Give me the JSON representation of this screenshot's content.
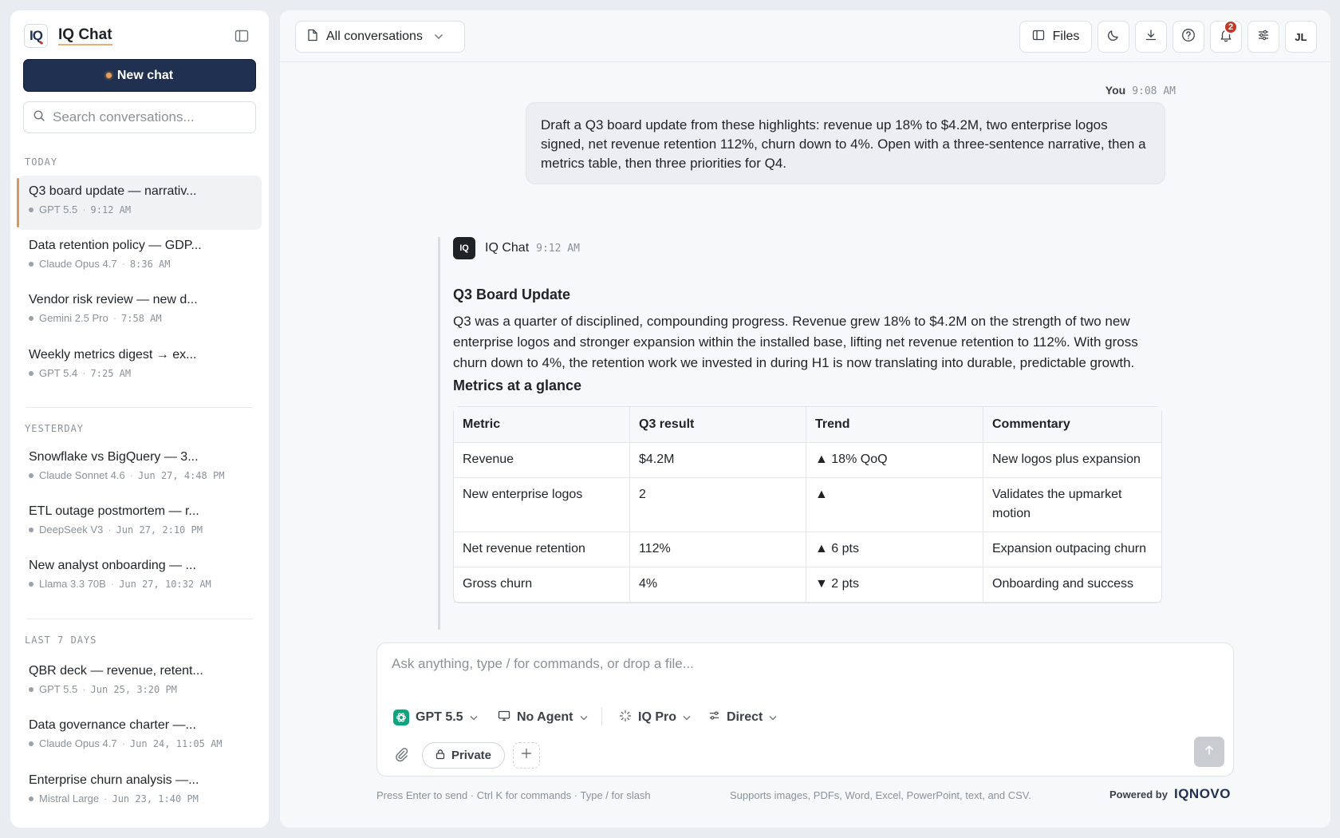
{
  "sidebar": {
    "brand_logo": "IQ",
    "brand_name": "IQ Chat",
    "new_chat": "New chat",
    "search_placeholder": "Search conversations...",
    "groups": {
      "today": "TODAY",
      "yesterday": "YESTERDAY",
      "last7": "LAST 7 DAYS"
    },
    "conversations": [
      {
        "title": "Q3 board update — narrativ...",
        "model": "GPT 5.5",
        "time": "9:12 AM"
      },
      {
        "title": "Data retention policy — GDP...",
        "model": "Claude Opus 4.7",
        "time": "8:36 AM"
      },
      {
        "title": "Vendor risk review — new d...",
        "model": "Gemini 2.5 Pro",
        "time": "7:58 AM"
      },
      {
        "title": "Weekly metrics digest → ex...",
        "model": "GPT 5.4",
        "time": "7:25 AM"
      },
      {
        "title": "Snowflake vs BigQuery — 3...",
        "model": "Claude Sonnet 4.6",
        "time": "Jun 27, 4:48 PM"
      },
      {
        "title": "ETL outage postmortem — r...",
        "model": "DeepSeek V3",
        "time": "Jun 27, 2:10 PM"
      },
      {
        "title": "New analyst onboarding — ...",
        "model": "Llama 3.3 70B",
        "time": "Jun 27, 10:32 AM"
      },
      {
        "title": "QBR deck — revenue, retent...",
        "model": "GPT 5.5",
        "time": "Jun 25, 3:20 PM"
      },
      {
        "title": "Data governance charter —...",
        "model": "Claude Opus 4.7",
        "time": "Jun 24, 11:05 AM"
      },
      {
        "title": "Enterprise churn analysis —...",
        "model": "Mistral Large",
        "time": "Jun 23, 1:40 PM"
      }
    ]
  },
  "topbar": {
    "conversation_filter": "All conversations",
    "files": "Files",
    "notification_count": "2",
    "avatar": "JL"
  },
  "chat": {
    "user_name": "You",
    "user_time": "9:08 AM",
    "user_message": "Draft a Q3 board update from these highlights: revenue up 18% to $4.2M, two enterprise logos signed, net revenue retention 112%, churn down to 4%. Open with a three-sentence narrative, then a metrics table, then three priorities for Q4.",
    "assistant_logo": "IQ",
    "assistant_name": "IQ Chat",
    "assistant_time": "9:12 AM",
    "heading": "Q3 Board Update",
    "narrative": "Q3 was a quarter of disciplined, compounding progress. Revenue grew 18% to $4.2M on the strength of two new enterprise logos and stronger expansion within the installed base, lifting net revenue retention to 112%. With gross churn down to 4%, the retention work we invested in during H1 is now translating into durable, predictable growth.",
    "table_heading": "Metrics at a glance",
    "table": {
      "headers": [
        "Metric",
        "Q3 result",
        "Trend",
        "Commentary"
      ],
      "rows": [
        [
          "Revenue",
          "$4.2M",
          "▲ 18% QoQ",
          "New logos plus expansion"
        ],
        [
          "New enterprise logos",
          "2",
          "▲",
          "Validates the upmarket motion"
        ],
        [
          "Net revenue retention",
          "112%",
          "▲ 6 pts",
          "Expansion outpacing churn"
        ],
        [
          "Gross churn",
          "4%",
          "▼ 2 pts",
          "Onboarding and success"
        ]
      ]
    }
  },
  "composer": {
    "placeholder": "Ask anything, type / for commands, or drop a file...",
    "model": "GPT 5.5",
    "agent": "No Agent",
    "mode": "IQ Pro",
    "routing": "Direct",
    "privacy": "Private",
    "hint_left": "Press Enter to send · Ctrl K for commands · Type / for slash",
    "hint_center": "Supports images, PDFs, Word, Excel, PowerPoint, text, and CSV.",
    "powered_by": "Powered by",
    "powered_logo": "IQNOVO"
  },
  "colors": {
    "navy": "#1f3050",
    "accent": "#d89b55",
    "badge": "#c0392b",
    "gpt_green": "#10a37f"
  }
}
